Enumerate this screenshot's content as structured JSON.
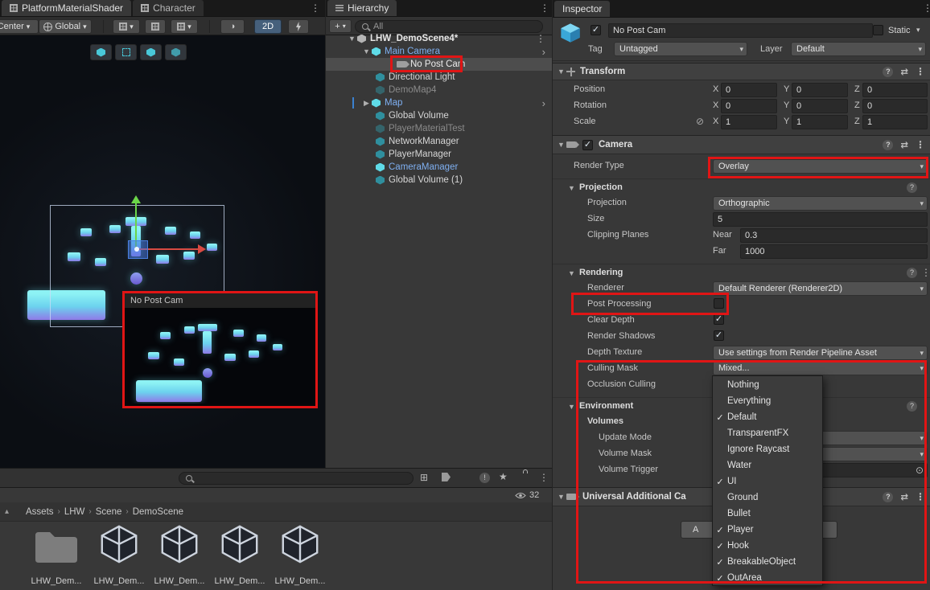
{
  "colors": {
    "annotation_red": "#e01515",
    "selection_gray": "#4d4d4d",
    "prefab_blue": "#7fb0f2",
    "panel_bg": "#383838",
    "teal_icon": "#49c8d8",
    "platform_cyan": "#8df2f4",
    "platform_purple": "#8f7ae8"
  },
  "icons": {
    "kebab": "⋮",
    "foldout_open": "▼",
    "foldout_closed": "▶",
    "dropdown_arrow": "▾",
    "check": "✓",
    "chevron_right": "›",
    "help": "?",
    "presets": "⇄",
    "link_off": "⊘",
    "target": "⊙",
    "star": "★",
    "plus": "+",
    "alert": "!",
    "half_sphere": "◑",
    "collapse_up": "▴",
    "breadcrumb_sep": "›"
  },
  "scene_panel": {
    "tabs": [
      {
        "label": "PlatformMaterialShader"
      },
      {
        "label": "Character"
      }
    ],
    "toolbar": {
      "handle_mode": "Center",
      "pivot_mode": "Global",
      "mode_2d": "2D"
    },
    "preview_title": "No Post Cam"
  },
  "hierarchy": {
    "tab_title": "Hierarchy",
    "search_text": "All",
    "items": [
      {
        "label": "LHW_DemoScene4*"
      },
      {
        "label": "Main Camera"
      },
      {
        "label": "No Post Cam"
      },
      {
        "label": "Directional Light"
      },
      {
        "label": "DemoMap4"
      },
      {
        "label": "Map"
      },
      {
        "label": "Global Volume"
      },
      {
        "label": "PlayerMaterialTest"
      },
      {
        "label": "NetworkManager"
      },
      {
        "label": "PlayerManager"
      },
      {
        "label": "CameraManager"
      },
      {
        "label": "Global Volume (1)"
      }
    ]
  },
  "inspector": {
    "tab_title": "Inspector",
    "gameobject": {
      "name": "No Post Cam",
      "static_label": "Static",
      "tag_label": "Tag",
      "tag_value": "Untagged",
      "layer_label": "Layer",
      "layer_value": "Default"
    },
    "axis": {
      "x": "X",
      "y": "Y",
      "z": "Z"
    },
    "transform": {
      "title": "Transform",
      "rows": [
        {
          "label": "Position",
          "x": "0",
          "y": "0",
          "z": "0"
        },
        {
          "label": "Rotation",
          "x": "0",
          "y": "0",
          "z": "0"
        },
        {
          "label": "Scale",
          "x": "1",
          "y": "1",
          "z": "1"
        }
      ]
    },
    "camera": {
      "title": "Camera",
      "render_type_label": "Render Type",
      "render_type_value": "Overlay",
      "projection_title": "Projection",
      "projection_label": "Projection",
      "projection_value": "Orthographic",
      "size_label": "Size",
      "size_value": "5",
      "clipping_label": "Clipping Planes",
      "near_label": "Near",
      "near_value": "0.3",
      "far_label": "Far",
      "far_value": "1000",
      "rendering_title": "Rendering",
      "renderer_label": "Renderer",
      "renderer_value": "Default Renderer (Renderer2D)",
      "post_processing_label": "Post Processing",
      "clear_depth_label": "Clear Depth",
      "render_shadows_label": "Render Shadows",
      "depth_texture_label": "Depth Texture",
      "depth_texture_value": "Use settings from Render Pipeline Asset",
      "culling_mask_label": "Culling Mask",
      "culling_mask_value": "Mixed...",
      "occlusion_label": "Occlusion Culling",
      "environment_title": "Environment",
      "volumes_label": "Volumes",
      "update_mode_label": "Update Mode",
      "volume_mask_label": "Volume Mask",
      "volume_trigger_label": "Volume Trigger"
    },
    "additional": {
      "title": "Universal Additional Ca",
      "button_label": "A"
    },
    "layer_menu": {
      "items": [
        {
          "label": "Nothing",
          "mark": ""
        },
        {
          "label": "Everything",
          "mark": ""
        },
        {
          "label": "Default",
          "mark": "✓"
        },
        {
          "label": "TransparentFX",
          "mark": ""
        },
        {
          "label": "Ignore Raycast",
          "mark": ""
        },
        {
          "label": "Water",
          "mark": ""
        },
        {
          "label": "UI",
          "mark": "✓"
        },
        {
          "label": "Ground",
          "mark": ""
        },
        {
          "label": "Bullet",
          "mark": ""
        },
        {
          "label": "Player",
          "mark": "✓"
        },
        {
          "label": "Hook",
          "mark": "✓"
        },
        {
          "label": "BreakableObject",
          "mark": "✓"
        },
        {
          "label": "OutArea",
          "mark": "✓"
        }
      ]
    }
  },
  "project": {
    "visible_count": "32",
    "breadcrumb": [
      "Assets",
      "LHW",
      "Scene",
      "DemoScene"
    ],
    "assets": [
      {
        "label": "LHW_Dem...",
        "type": "folder"
      },
      {
        "label": "LHW_Dem...",
        "type": "scene"
      },
      {
        "label": "LHW_Dem...",
        "type": "scene"
      },
      {
        "label": "LHW_Dem...",
        "type": "scene"
      },
      {
        "label": "LHW_Dem...",
        "type": "scene"
      }
    ]
  }
}
